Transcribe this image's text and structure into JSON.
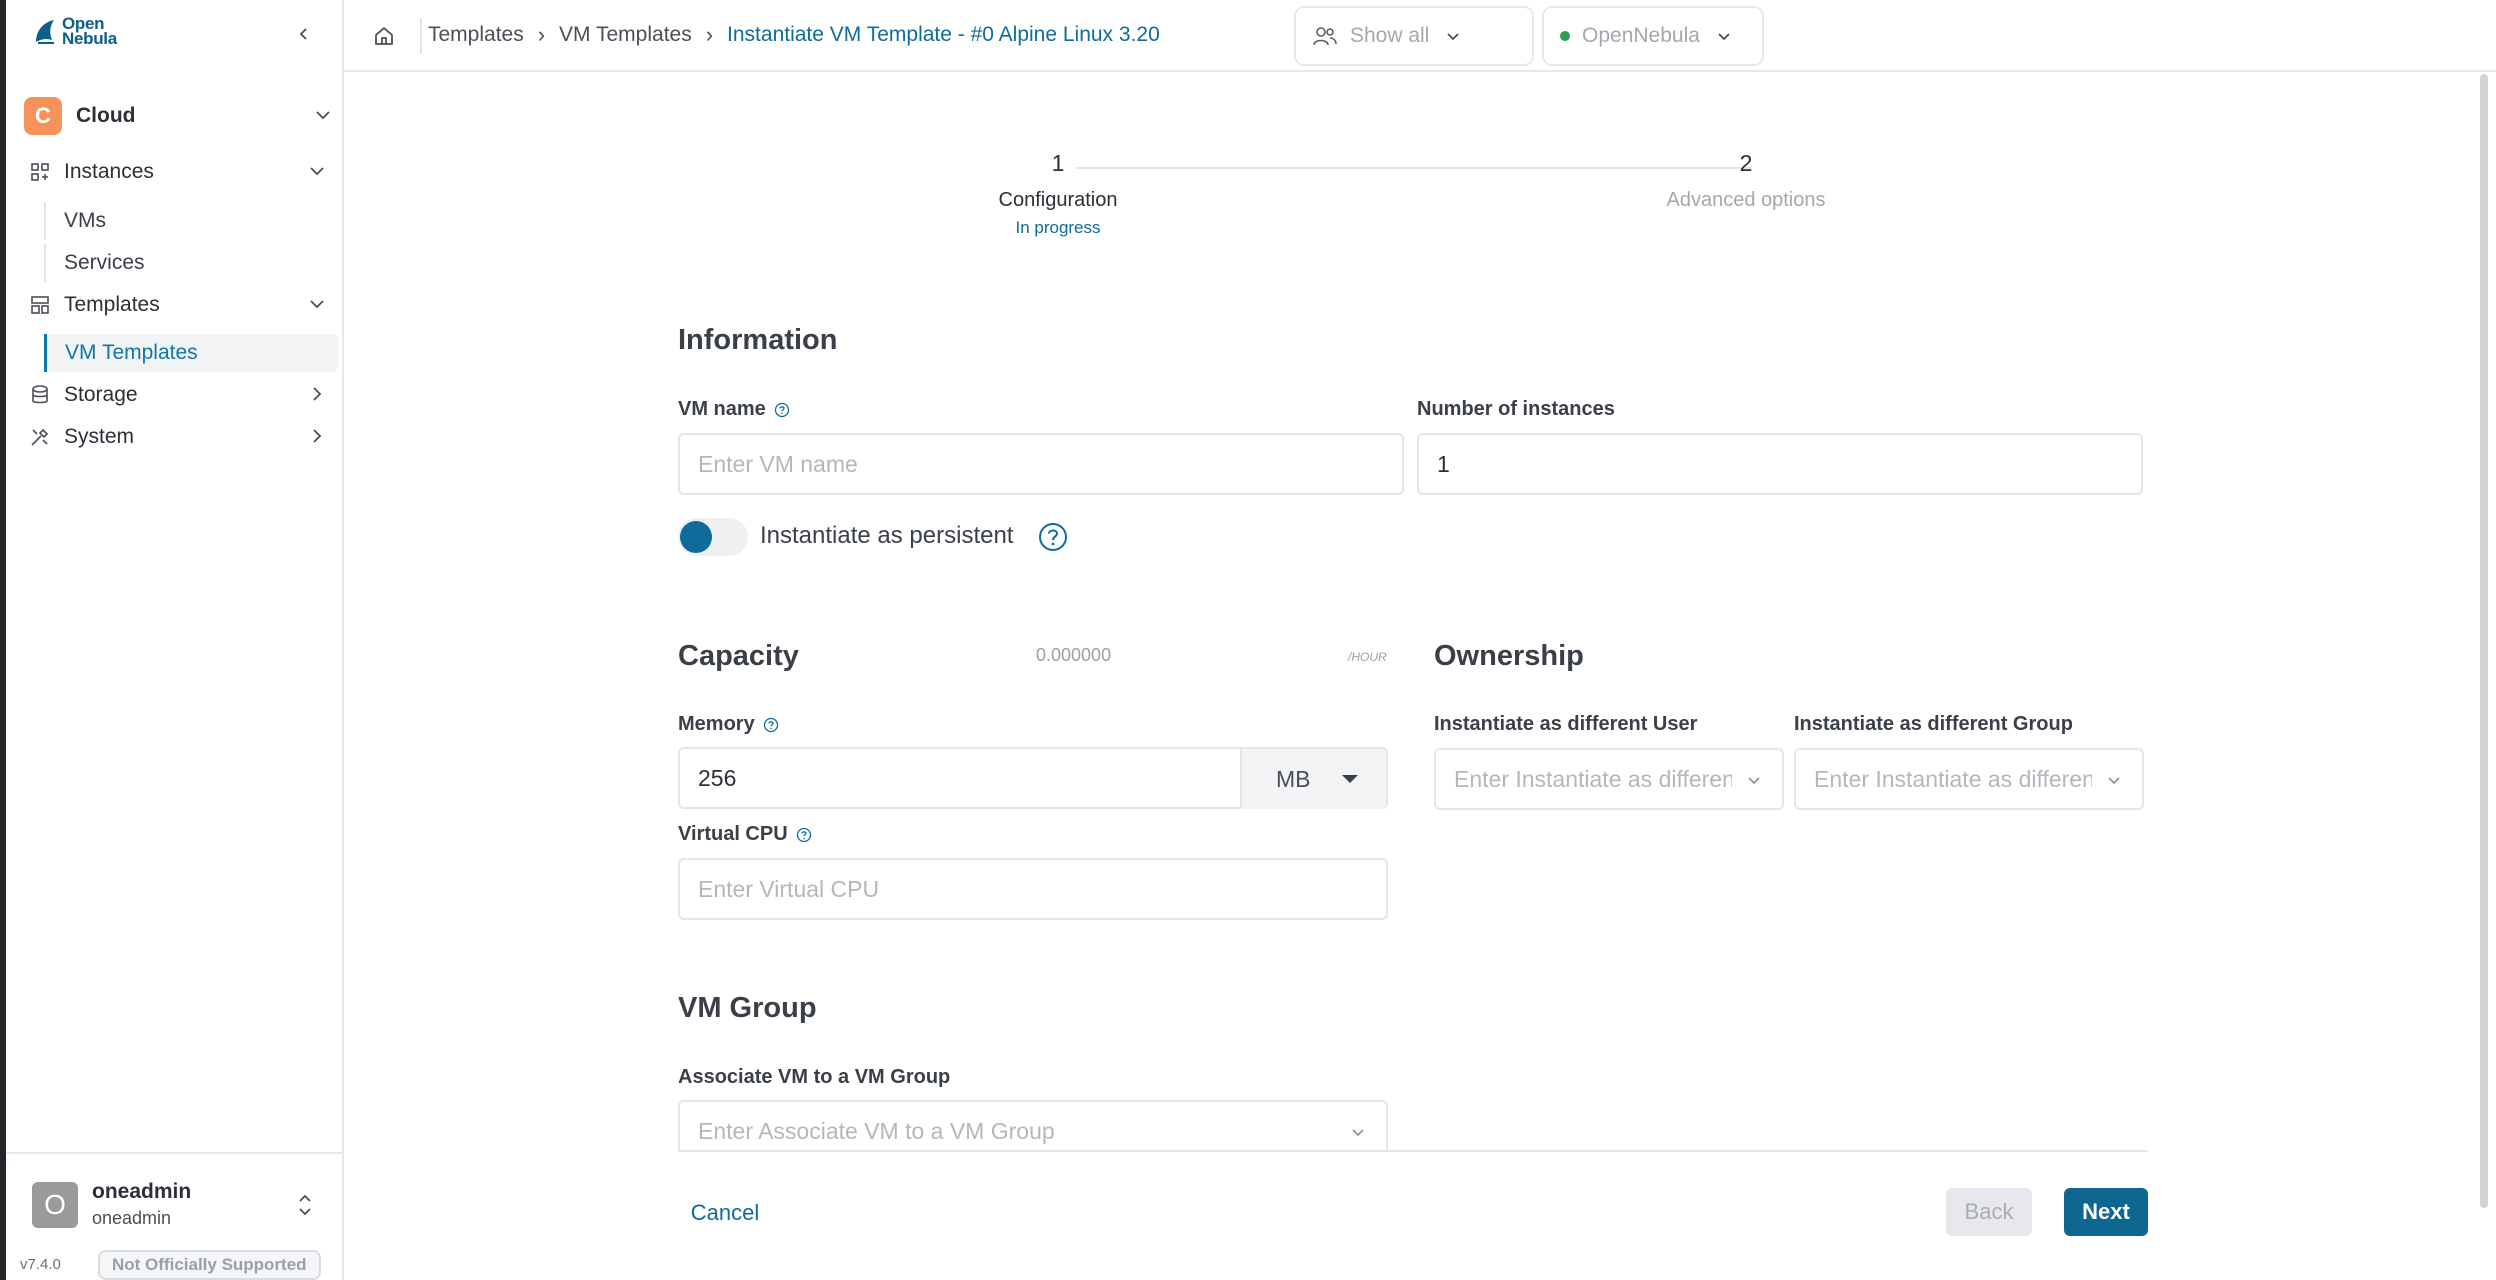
{
  "app": {
    "logo_line1": "Open",
    "logo_line2": "Nebula",
    "version": "v7.4.0",
    "support_badge": "Not Officially Supported"
  },
  "sidebar": {
    "group": {
      "avatar_letter": "C",
      "label": "Cloud"
    },
    "sections": [
      {
        "label": "Instances",
        "icon": "grid-icon",
        "items": [
          "VMs",
          "Services"
        ]
      },
      {
        "label": "Templates",
        "icon": "template-icon",
        "items": [
          "VM Templates"
        ]
      },
      {
        "label": "Storage",
        "icon": "database-icon",
        "items": []
      },
      {
        "label": "System",
        "icon": "tools-icon",
        "items": []
      }
    ],
    "active_item": "VM Templates",
    "user": {
      "avatar_letter": "O",
      "name": "oneadmin",
      "group": "oneadmin"
    }
  },
  "topbar": {
    "breadcrumb": [
      "Templates",
      "VM Templates",
      "Instantiate VM Template - #0 Alpine Linux 3.20"
    ],
    "filter_label": "Show all",
    "zone_label": "OpenNebula",
    "zone_status_color": "#2aa04c"
  },
  "stepper": {
    "steps": [
      {
        "number": "1",
        "title": "Configuration",
        "status": "In progress"
      },
      {
        "number": "2",
        "title": "Advanced options",
        "status": ""
      }
    ]
  },
  "form": {
    "information": {
      "title": "Information",
      "vm_name_label": "VM name",
      "vm_name_placeholder": "Enter VM name",
      "instances_label": "Number of instances",
      "instances_value": "1",
      "persistent_label": "Instantiate as persistent"
    },
    "capacity": {
      "title": "Capacity",
      "cost": "0.000000",
      "cost_unit": "/HOUR",
      "memory_label": "Memory",
      "memory_value": "256",
      "memory_unit": "MB",
      "vcpu_label": "Virtual CPU",
      "vcpu_placeholder": "Enter Virtual CPU"
    },
    "ownership": {
      "title": "Ownership",
      "user_label": "Instantiate as different User",
      "user_placeholder": "Enter Instantiate as different User",
      "group_label": "Instantiate as different Group",
      "group_placeholder": "Enter Instantiate as different Group"
    },
    "vm_group": {
      "title": "VM Group",
      "label": "Associate VM to a VM Group",
      "placeholder": "Enter Associate VM to a VM Group"
    }
  },
  "actions": {
    "cancel": "Cancel",
    "back": "Back",
    "next": "Next"
  },
  "colors": {
    "accent": "#0e6b9a",
    "primary_button": "#0d6790",
    "cloud_avatar": "#f5935a"
  }
}
